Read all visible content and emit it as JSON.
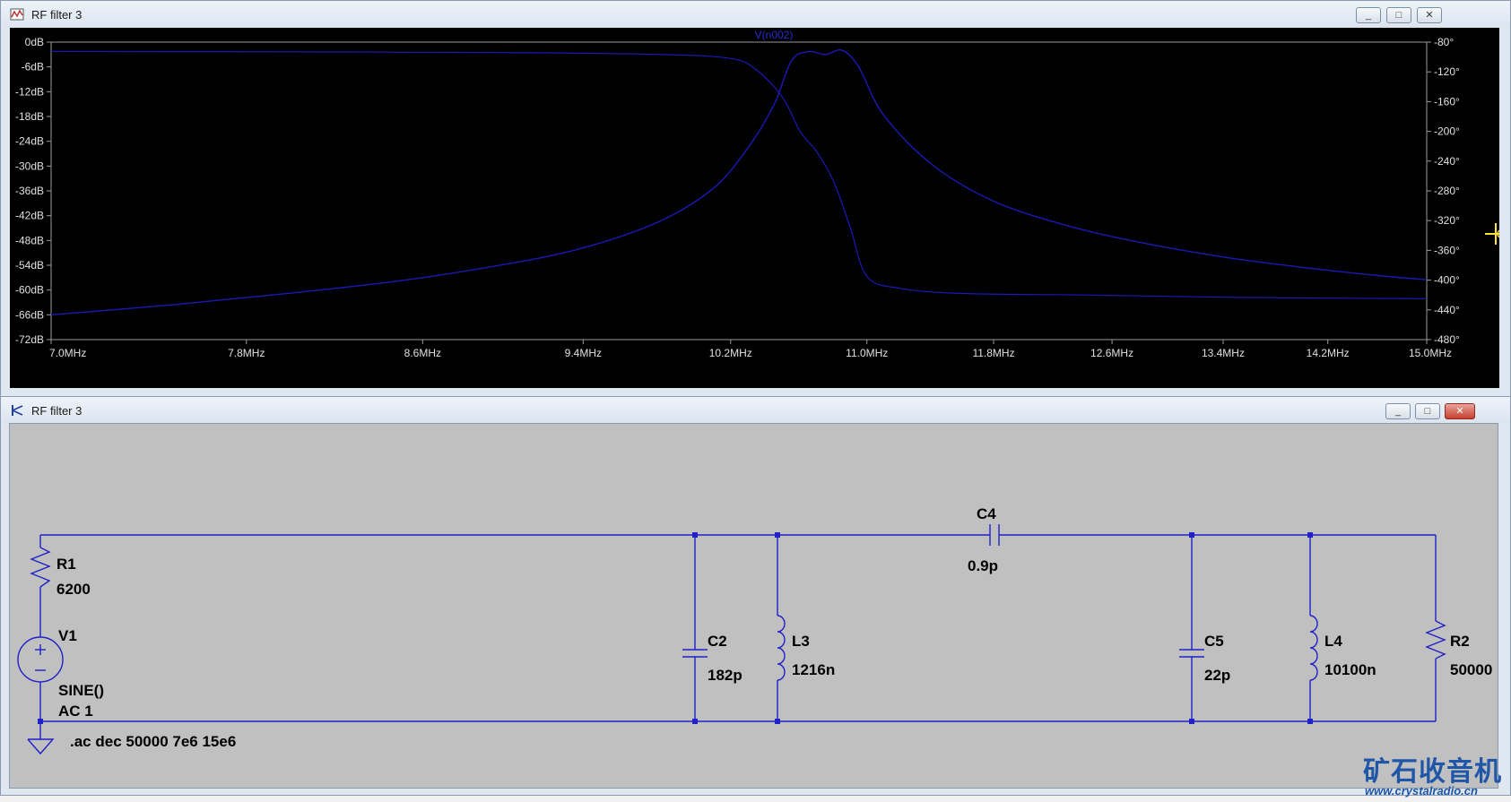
{
  "waveform_window": {
    "title": "RF filter 3",
    "controls": [
      "_",
      "□",
      "✕"
    ],
    "trace_label": "V(n002)",
    "trace_color": "#1a1ab4",
    "cursor_icon": "crosshair-cursor-icon"
  },
  "schematic_window": {
    "title": "RF filter 3",
    "controls": [
      "_",
      "□",
      "✕"
    ],
    "wire_color": "#2121c8",
    "components": {
      "R1": {
        "name": "R1",
        "value": "6200"
      },
      "V1": {
        "name": "V1",
        "value": "SINE()",
        "value2": "AC 1"
      },
      "C2": {
        "name": "C2",
        "value": "182p"
      },
      "L3": {
        "name": "L3",
        "value": "1216n"
      },
      "C4": {
        "name": "C4",
        "value": "0.9p"
      },
      "C5": {
        "name": "C5",
        "value": "22p"
      },
      "L4": {
        "name": "L4",
        "value": "10100n"
      },
      "R2": {
        "name": "R2",
        "value": "50000"
      }
    },
    "directive": ".ac dec 50000 7e6 15e6"
  },
  "watermark": {
    "text": "矿石收音机",
    "url": "www.crystalradio.cn"
  },
  "chart_data": {
    "type": "line",
    "title": "V(n002)",
    "xscale": "log",
    "xlim": [
      7.0,
      15.0
    ],
    "xticks": [
      "7.0MHz",
      "7.8MHz",
      "8.6MHz",
      "9.4MHz",
      "10.2MHz",
      "11.0MHz",
      "11.8MHz",
      "12.6MHz",
      "13.4MHz",
      "14.2MHz",
      "15.0MHz"
    ],
    "xtick_values": [
      7.0,
      7.8,
      8.6,
      9.4,
      10.2,
      11.0,
      11.8,
      12.6,
      13.4,
      14.2,
      15.0
    ],
    "ylim_left": [
      -72,
      0
    ],
    "yticks_left": [
      "0dB",
      "-6dB",
      "-12dB",
      "-18dB",
      "-24dB",
      "-30dB",
      "-36dB",
      "-42dB",
      "-48dB",
      "-54dB",
      "-60dB",
      "-66dB",
      "-72dB"
    ],
    "ylim_right": [
      -480,
      -80
    ],
    "yticks_right": [
      "-80°",
      "-120°",
      "-160°",
      "-200°",
      "-240°",
      "-280°",
      "-320°",
      "-360°",
      "-400°",
      "-440°",
      "-480°"
    ],
    "series": [
      {
        "kind": "magnitude_dB",
        "x": [
          7.0,
          7.5,
          8.0,
          8.5,
          9.0,
          9.4,
          9.8,
          10.1,
          10.3,
          10.45,
          10.55,
          10.65,
          10.75,
          10.85,
          10.95,
          11.1,
          11.4,
          11.8,
          12.3,
          12.8,
          13.4,
          14.0,
          14.6,
          15.0
        ],
        "y": [
          -66.0,
          -63.5,
          -60.7,
          -57.7,
          -53.8,
          -49.8,
          -43.5,
          -35.5,
          -25.5,
          -15.0,
          -4.5,
          -2.3,
          -3.0,
          -2.0,
          -6.0,
          -17.5,
          -29.5,
          -38.5,
          -44.5,
          -48.5,
          -52.0,
          -54.5,
          -56.5,
          -57.5
        ]
      },
      {
        "kind": "phase_deg",
        "x": [
          7.0,
          8.0,
          9.0,
          9.8,
          10.2,
          10.35,
          10.5,
          10.6,
          10.7,
          10.8,
          10.9,
          11.0,
          11.2,
          11.6,
          12.4,
          13.4,
          15.0
        ],
        "y": [
          -92.5,
          -93.0,
          -94.0,
          -96.5,
          -102,
          -118,
          -155,
          -200,
          -228,
          -268,
          -330,
          -395,
          -411,
          -418,
          -420,
          -423,
          -425
        ]
      }
    ]
  }
}
